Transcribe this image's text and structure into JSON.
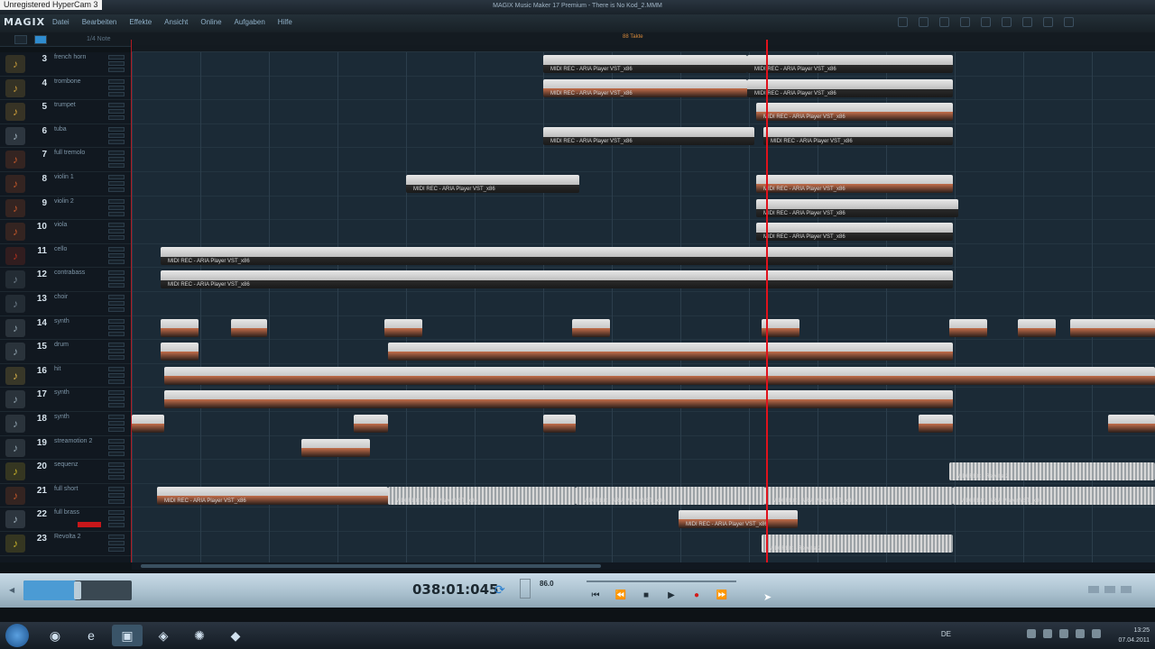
{
  "watermark": "Unregistered HyperCam 3",
  "window": {
    "title": "MAGIX Music Maker 17 Premium  -  There is No Kod_2.MMM"
  },
  "app": {
    "logo": "MAGIX"
  },
  "menu": [
    "Datei",
    "Bearbeiten",
    "Effekte",
    "Ansicht",
    "Online",
    "Aufgaben",
    "Hilfe"
  ],
  "toolbar": {
    "zoom_label": "1/4 Note",
    "tempo_marker": "88 Takte"
  },
  "tracks": [
    {
      "num": "3",
      "name": "french horn",
      "icon": "horn-icon",
      "color": "#c59a3a"
    },
    {
      "num": "4",
      "name": "trombone",
      "icon": "trombone-icon",
      "color": "#c59a3a"
    },
    {
      "num": "5",
      "name": "trumpet",
      "icon": "trumpet-icon",
      "color": "#d4a23c"
    },
    {
      "num": "6",
      "name": "tuba",
      "icon": "tuba-icon",
      "color": "#a0b0bc"
    },
    {
      "num": "7",
      "name": "full tremolo",
      "icon": "violin-icon",
      "color": "#c2572a"
    },
    {
      "num": "8",
      "name": "violin 1",
      "icon": "violin-icon",
      "color": "#c2572a"
    },
    {
      "num": "9",
      "name": "violin 2",
      "icon": "violin-icon",
      "color": "#c2572a"
    },
    {
      "num": "10",
      "name": "viola",
      "icon": "violin-icon",
      "color": "#c2572a"
    },
    {
      "num": "11",
      "name": "cello",
      "icon": "cello-icon",
      "color": "#b2301e"
    },
    {
      "num": "12",
      "name": "contrabass",
      "icon": "contrabass-icon",
      "color": "#6e7c88"
    },
    {
      "num": "13",
      "name": "choir",
      "icon": "choir-icon",
      "color": "#6e7c88"
    },
    {
      "num": "14",
      "name": "synth",
      "icon": "synth-icon",
      "color": "#8fa0ac"
    },
    {
      "num": "15",
      "name": "drum",
      "icon": "drum-icon",
      "color": "#8fa0ac"
    },
    {
      "num": "16",
      "name": "hit",
      "icon": "cymbal-icon",
      "color": "#d9b24a"
    },
    {
      "num": "17",
      "name": "synth",
      "icon": "synth-icon",
      "color": "#8fa0ac"
    },
    {
      "num": "18",
      "name": "synth",
      "icon": "synth-icon",
      "color": "#8fa0ac"
    },
    {
      "num": "19",
      "name": "streamotion 2",
      "icon": "rack-icon",
      "color": "#8fa0ac"
    },
    {
      "num": "20",
      "name": "sequenz",
      "icon": "sound-fx-icon",
      "color": "#c6b02a"
    },
    {
      "num": "21",
      "name": "full short",
      "icon": "violin-icon",
      "color": "#c2572a"
    },
    {
      "num": "22",
      "name": "full brass",
      "icon": "brass-icon",
      "color": "#a0b0bc"
    },
    {
      "num": "23",
      "name": "Revolta 2",
      "icon": "sound-fx-icon",
      "color": "#c6b02a"
    }
  ],
  "clip_labels": {
    "aria": "MIDI REC - ARIA Player VST_x86",
    "revolta": "MIDI REC - Revolta 2"
  },
  "transport": {
    "time": "038:01:045",
    "bpm": "86.0",
    "prev_label": "⏮",
    "rewind_label": "⏪",
    "stop_label": "■",
    "play_label": "▶",
    "record_label": "●",
    "forward_label": "⏩"
  },
  "taskbar": {
    "lang": "DE",
    "time": "13:25",
    "date": "07.04.2011"
  }
}
